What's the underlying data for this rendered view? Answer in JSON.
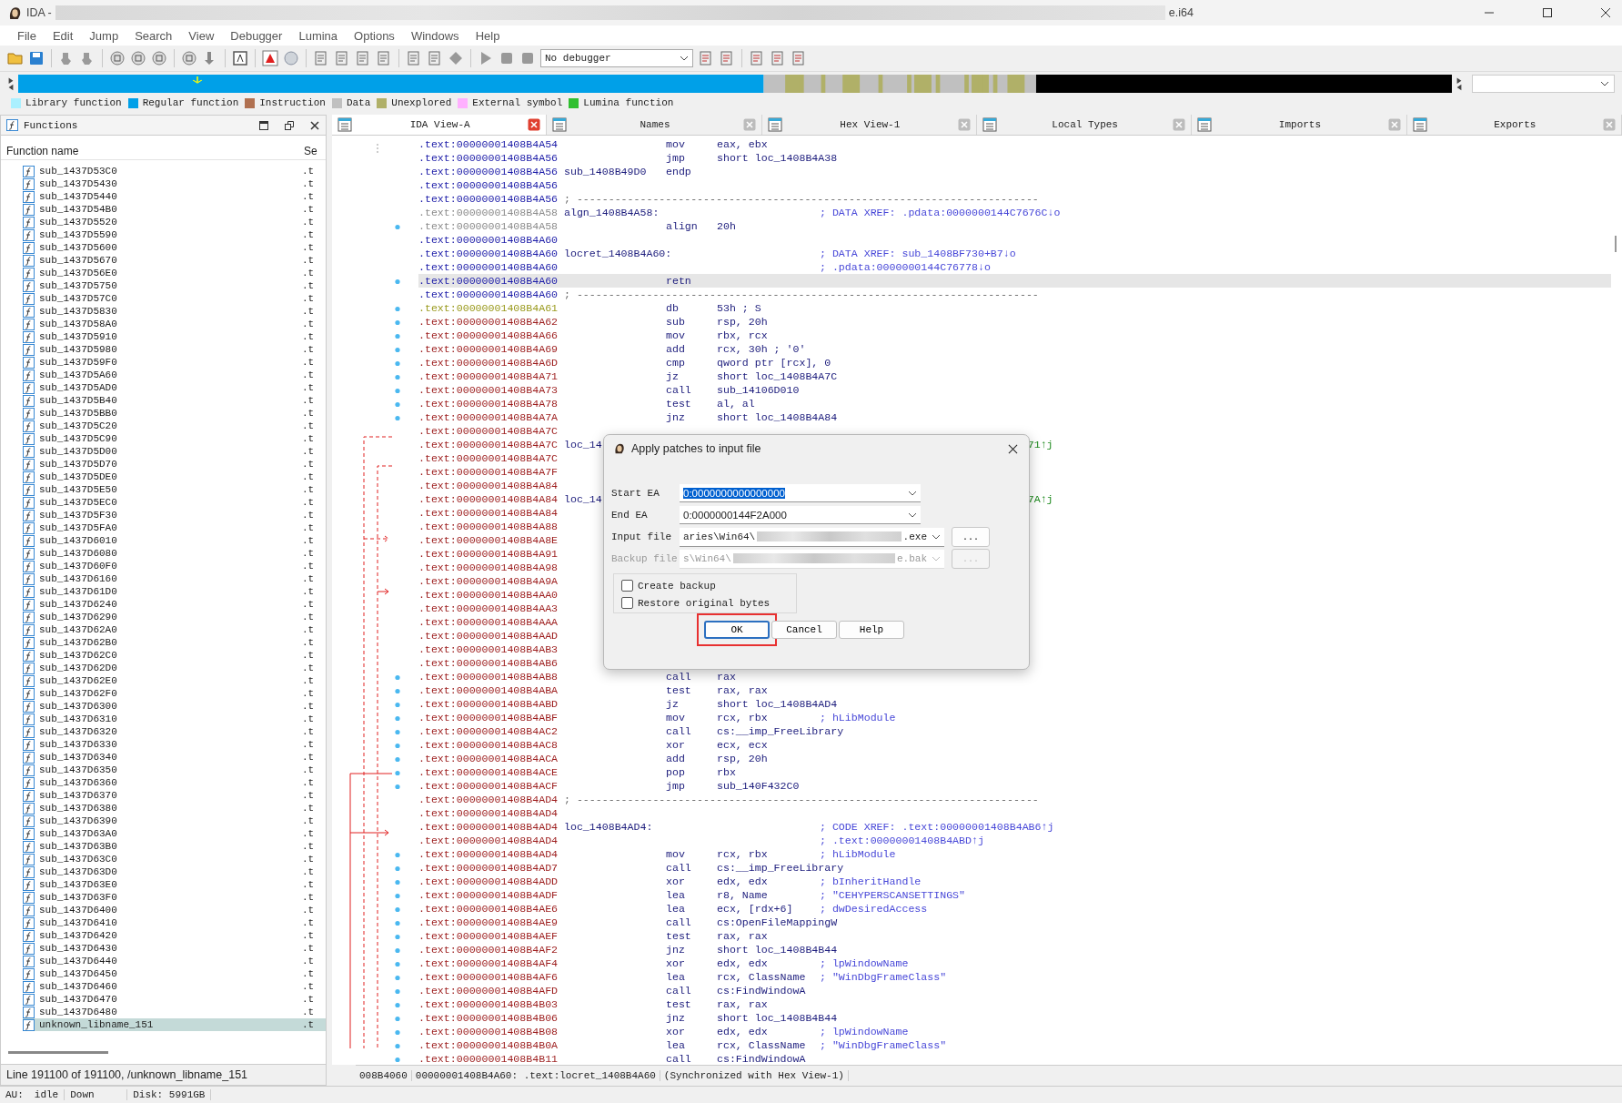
{
  "window": {
    "title": "IDA -",
    "title_suffix": "e.i64"
  },
  "menu": [
    "File",
    "Edit",
    "Jump",
    "Search",
    "View",
    "Debugger",
    "Lumina",
    "Options",
    "Windows",
    "Help"
  ],
  "toolbar": {
    "debugger": "No debugger"
  },
  "legend": [
    {
      "label": "Library function",
      "color": "#aaf0ff"
    },
    {
      "label": "Regular function",
      "color": "#00a0e8"
    },
    {
      "label": "Instruction",
      "color": "#b07050"
    },
    {
      "label": "Data",
      "color": "#c0c0c0"
    },
    {
      "label": "Unexplored",
      "color": "#b0b068"
    },
    {
      "label": "External symbol",
      "color": "#ffb0ff"
    },
    {
      "label": "Lumina function",
      "color": "#30c030"
    }
  ],
  "functions_pane": {
    "title": "Functions",
    "columns": [
      "Function name",
      "Se"
    ],
    "rows": [
      {
        "name": "sub_1437D53C0",
        "segment": ".t",
        "selected": false
      },
      {
        "name": "sub_1437D5430",
        "segment": ".t",
        "selected": false
      },
      {
        "name": "sub_1437D5440",
        "segment": ".t",
        "selected": false
      },
      {
        "name": "sub_1437D54B0",
        "segment": ".t",
        "selected": false
      },
      {
        "name": "sub_1437D5520",
        "segment": ".t",
        "selected": false
      },
      {
        "name": "sub_1437D5590",
        "segment": ".t",
        "selected": false
      },
      {
        "name": "sub_1437D5600",
        "segment": ".t",
        "selected": false
      },
      {
        "name": "sub_1437D5670",
        "segment": ".t",
        "selected": false
      },
      {
        "name": "sub_1437D56E0",
        "segment": ".t",
        "selected": false
      },
      {
        "name": "sub_1437D5750",
        "segment": ".t",
        "selected": false
      },
      {
        "name": "sub_1437D57C0",
        "segment": ".t",
        "selected": false
      },
      {
        "name": "sub_1437D5830",
        "segment": ".t",
        "selected": false
      },
      {
        "name": "sub_1437D58A0",
        "segment": ".t",
        "selected": false
      },
      {
        "name": "sub_1437D5910",
        "segment": ".t",
        "selected": false
      },
      {
        "name": "sub_1437D5980",
        "segment": ".t",
        "selected": false
      },
      {
        "name": "sub_1437D59F0",
        "segment": ".t",
        "selected": false
      },
      {
        "name": "sub_1437D5A60",
        "segment": ".t",
        "selected": false
      },
      {
        "name": "sub_1437D5AD0",
        "segment": ".t",
        "selected": false
      },
      {
        "name": "sub_1437D5B40",
        "segment": ".t",
        "selected": false
      },
      {
        "name": "sub_1437D5BB0",
        "segment": ".t",
        "selected": false
      },
      {
        "name": "sub_1437D5C20",
        "segment": ".t",
        "selected": false
      },
      {
        "name": "sub_1437D5C90",
        "segment": ".t",
        "selected": false
      },
      {
        "name": "sub_1437D5D00",
        "segment": ".t",
        "selected": false
      },
      {
        "name": "sub_1437D5D70",
        "segment": ".t",
        "selected": false
      },
      {
        "name": "sub_1437D5DE0",
        "segment": ".t",
        "selected": false
      },
      {
        "name": "sub_1437D5E50",
        "segment": ".t",
        "selected": false
      },
      {
        "name": "sub_1437D5EC0",
        "segment": ".t",
        "selected": false
      },
      {
        "name": "sub_1437D5F30",
        "segment": ".t",
        "selected": false
      },
      {
        "name": "sub_1437D5FA0",
        "segment": ".t",
        "selected": false
      },
      {
        "name": "sub_1437D6010",
        "segment": ".t",
        "selected": false
      },
      {
        "name": "sub_1437D6080",
        "segment": ".t",
        "selected": false
      },
      {
        "name": "sub_1437D60F0",
        "segment": ".t",
        "selected": false
      },
      {
        "name": "sub_1437D6160",
        "segment": ".t",
        "selected": false
      },
      {
        "name": "sub_1437D61D0",
        "segment": ".t",
        "selected": false
      },
      {
        "name": "sub_1437D6240",
        "segment": ".t",
        "selected": false
      },
      {
        "name": "sub_1437D6290",
        "segment": ".t",
        "selected": false
      },
      {
        "name": "sub_1437D62A0",
        "segment": ".t",
        "selected": false
      },
      {
        "name": "sub_1437D62B0",
        "segment": ".t",
        "selected": false
      },
      {
        "name": "sub_1437D62C0",
        "segment": ".t",
        "selected": false
      },
      {
        "name": "sub_1437D62D0",
        "segment": ".t",
        "selected": false
      },
      {
        "name": "sub_1437D62E0",
        "segment": ".t",
        "selected": false
      },
      {
        "name": "sub_1437D62F0",
        "segment": ".t",
        "selected": false
      },
      {
        "name": "sub_1437D6300",
        "segment": ".t",
        "selected": false
      },
      {
        "name": "sub_1437D6310",
        "segment": ".t",
        "selected": false
      },
      {
        "name": "sub_1437D6320",
        "segment": ".t",
        "selected": false
      },
      {
        "name": "sub_1437D6330",
        "segment": ".t",
        "selected": false
      },
      {
        "name": "sub_1437D6340",
        "segment": ".t",
        "selected": false
      },
      {
        "name": "sub_1437D6350",
        "segment": ".t",
        "selected": false
      },
      {
        "name": "sub_1437D6360",
        "segment": ".t",
        "selected": false
      },
      {
        "name": "sub_1437D6370",
        "segment": ".t",
        "selected": false
      },
      {
        "name": "sub_1437D6380",
        "segment": ".t",
        "selected": false
      },
      {
        "name": "sub_1437D6390",
        "segment": ".t",
        "selected": false
      },
      {
        "name": "sub_1437D63A0",
        "segment": ".t",
        "selected": false
      },
      {
        "name": "sub_1437D63B0",
        "segment": ".t",
        "selected": false
      },
      {
        "name": "sub_1437D63C0",
        "segment": ".t",
        "selected": false
      },
      {
        "name": "sub_1437D63D0",
        "segment": ".t",
        "selected": false
      },
      {
        "name": "sub_1437D63E0",
        "segment": ".t",
        "selected": false
      },
      {
        "name": "sub_1437D63F0",
        "segment": ".t",
        "selected": false
      },
      {
        "name": "sub_1437D6400",
        "segment": ".t",
        "selected": false
      },
      {
        "name": "sub_1437D6410",
        "segment": ".t",
        "selected": false
      },
      {
        "name": "sub_1437D6420",
        "segment": ".t",
        "selected": false
      },
      {
        "name": "sub_1437D6430",
        "segment": ".t",
        "selected": false
      },
      {
        "name": "sub_1437D6440",
        "segment": ".t",
        "selected": false
      },
      {
        "name": "sub_1437D6450",
        "segment": ".t",
        "selected": false
      },
      {
        "name": "sub_1437D6460",
        "segment": ".t",
        "selected": false
      },
      {
        "name": "sub_1437D6470",
        "segment": ".t",
        "selected": false
      },
      {
        "name": "sub_1437D6480",
        "segment": ".t",
        "selected": false
      },
      {
        "name": "unknown_libname_151",
        "segment": ".t",
        "selected": true
      }
    ],
    "status": "Line 191100 of 191100, /unknown_libname_151"
  },
  "tabs": [
    {
      "label": "IDA View-A",
      "selected": true
    },
    {
      "label": "Names",
      "selected": false
    },
    {
      "label": "Hex View-1",
      "selected": false
    },
    {
      "label": "Local Types",
      "selected": false
    },
    {
      "label": "Imports",
      "selected": false
    },
    {
      "label": "Exports",
      "selected": false
    }
  ],
  "listing": [
    {
      "address": ".text:00000001408B4A54",
      "color": "#1c1ca8",
      "mnemonic": "mov",
      "operands": "eax, ebx",
      "selected": false
    },
    {
      "address": ".text:00000001408B4A56",
      "color": "#1c1ca8",
      "mnemonic": "jmp",
      "operands": "short loc_1408B4A38",
      "selected": false
    },
    {
      "address": ".text:00000001408B4A56",
      "color": "#1c1ca8",
      "label": "sub_1408B49D0",
      "mnemonic": "endp",
      "selected": false
    },
    {
      "address": ".text:00000001408B4A56",
      "color": "#1c1ca8",
      "selected": false
    },
    {
      "address": ".text:00000001408B4A56",
      "color": "#1c1ca8",
      "separator": "; -------------------------------------------------------------------------",
      "selected": false
    },
    {
      "address": ".text:00000001408B4A58",
      "color": "#8c8c8c",
      "label": "algn_1408B4A58:",
      "comment": "; DATA XREF: .pdata:0000000144C7676C↓o",
      "selected": false
    },
    {
      "address": ".text:00000001408B4A58",
      "color": "#8c8c8c",
      "mnemonic": "align",
      "operands": "20h",
      "selected": false
    },
    {
      "address": ".text:00000001408B4A60",
      "color": "#1c1ca8",
      "selected": false
    },
    {
      "address": ".text:00000001408B4A60",
      "color": "#1c1ca8",
      "label": "locret_1408B4A60:",
      "comment": "; DATA XREF: sub_1408BF730+B7↓o",
      "selected": false
    },
    {
      "address": ".text:00000001408B4A60",
      "color": "#1c1ca8",
      "comment": "; .pdata:0000000144C76778↓o",
      "selected": false
    },
    {
      "address": ".text:00000001408B4A60",
      "color": "#1c1ca8",
      "mnemonic": "retn",
      "selected": true
    },
    {
      "address": ".text:00000001408B4A60",
      "color": "#1c1ca8",
      "separator": "; -------------------------------------------------------------------------",
      "selected": false
    },
    {
      "address": ".text:00000001408B4A61",
      "color": "#9a9a1e",
      "mnemonic": "db",
      "operands": "53h ; S",
      "selected": false
    },
    {
      "address": ".text:00000001408B4A62",
      "color": "#9c1c1c",
      "mnemonic": "sub",
      "operands": "rsp, 20h",
      "selected": false
    },
    {
      "address": ".text:00000001408B4A66",
      "color": "#9c1c1c",
      "mnemonic": "mov",
      "operands": "rbx, rcx",
      "selected": false
    },
    {
      "address": ".text:00000001408B4A69",
      "color": "#9c1c1c",
      "mnemonic": "add",
      "operands": "rcx, 30h ; '0'",
      "selected": false
    },
    {
      "address": ".text:00000001408B4A6D",
      "color": "#9c1c1c",
      "mnemonic": "cmp",
      "operands": "qword ptr [rcx], 0",
      "selected": false
    },
    {
      "address": ".text:00000001408B4A71",
      "color": "#9c1c1c",
      "mnemonic": "jz",
      "operands": "short loc_1408B4A7C",
      "selected": false
    },
    {
      "address": ".text:00000001408B4A73",
      "color": "#9c1c1c",
      "mnemonic": "call",
      "operands": "sub_14106D010",
      "selected": false
    },
    {
      "address": ".text:00000001408B4A78",
      "color": "#9c1c1c",
      "mnemonic": "test",
      "operands": "al, al",
      "selected": false
    },
    {
      "address": ".text:00000001408B4A7A",
      "color": "#9c1c1c",
      "mnemonic": "jnz",
      "operands": "short loc_1408B4A84",
      "selected": false
    },
    {
      "address": ".text:00000001408B4A7C",
      "color": "#9c1c1c",
      "selected": false
    },
    {
      "address": ".text:00000001408B4A7C",
      "color": "#9c1c1c",
      "label": "loc_14",
      "tail": "71↑j",
      "selected": false
    },
    {
      "address": ".text:00000001408B4A7C",
      "color": "#9c1c1c",
      "selected": false
    },
    {
      "address": ".text:00000001408B4A7F",
      "color": "#9c1c1c",
      "selected": false
    },
    {
      "address": ".text:00000001408B4A84",
      "color": "#9c1c1c",
      "selected": false
    },
    {
      "address": ".text:00000001408B4A84",
      "color": "#9c1c1c",
      "label": "loc_14",
      "tail": "7A↑j",
      "selected": false
    },
    {
      "address": ".text:00000001408B4A84",
      "color": "#9c1c1c",
      "selected": false
    },
    {
      "address": ".text:00000001408B4A88",
      "color": "#9c1c1c",
      "selected": false
    },
    {
      "address": ".text:00000001408B4A8E",
      "color": "#9c1c1c",
      "selected": false
    },
    {
      "address": ".text:00000001408B4A91",
      "color": "#9c1c1c",
      "selected": false
    },
    {
      "address": ".text:00000001408B4A98",
      "color": "#9c1c1c",
      "selected": false
    },
    {
      "address": ".text:00000001408B4A9A",
      "color": "#9c1c1c",
      "selected": false
    },
    {
      "address": ".text:00000001408B4AA0",
      "color": "#9c1c1c",
      "selected": false
    },
    {
      "address": ".text:00000001408B4AA3",
      "color": "#9c1c1c",
      "selected": false
    },
    {
      "address": ".text:00000001408B4AAA",
      "color": "#9c1c1c",
      "selected": false
    },
    {
      "address": ".text:00000001408B4AAD",
      "color": "#9c1c1c",
      "selected": false
    },
    {
      "address": ".text:00000001408B4AB3",
      "color": "#9c1c1c",
      "selected": false
    },
    {
      "address": ".text:00000001408B4AB6",
      "color": "#9c1c1c",
      "selected": false
    },
    {
      "address": ".text:00000001408B4AB8",
      "color": "#9c1c1c",
      "mnemonic": "call",
      "operands": "rax",
      "selected": false
    },
    {
      "address": ".text:00000001408B4ABA",
      "color": "#9c1c1c",
      "mnemonic": "test",
      "operands": "rax, rax",
      "selected": false
    },
    {
      "address": ".text:00000001408B4ABD",
      "color": "#9c1c1c",
      "mnemonic": "jz",
      "operands": "short loc_1408B4AD4",
      "selected": false
    },
    {
      "address": ".text:00000001408B4ABF",
      "color": "#9c1c1c",
      "mnemonic": "mov",
      "operands": "rcx, rbx",
      "comment": "; hLibModule",
      "selected": false
    },
    {
      "address": ".text:00000001408B4AC2",
      "color": "#9c1c1c",
      "mnemonic": "call",
      "operands": "cs:__imp_FreeLibrary",
      "selected": false
    },
    {
      "address": ".text:00000001408B4AC8",
      "color": "#9c1c1c",
      "mnemonic": "xor",
      "operands": "ecx, ecx",
      "selected": false
    },
    {
      "address": ".text:00000001408B4ACA",
      "color": "#9c1c1c",
      "mnemonic": "add",
      "operands": "rsp, 20h",
      "selected": false
    },
    {
      "address": ".text:00000001408B4ACE",
      "color": "#9c1c1c",
      "mnemonic": "pop",
      "operands": "rbx",
      "selected": false
    },
    {
      "address": ".text:00000001408B4ACF",
      "color": "#9c1c1c",
      "mnemonic": "jmp",
      "operands": "sub_140F432C0",
      "selected": false
    },
    {
      "address": ".text:00000001408B4AD4",
      "color": "#9c1c1c",
      "separator": "; -------------------------------------------------------------------------",
      "selected": false
    },
    {
      "address": ".text:00000001408B4AD4",
      "color": "#9c1c1c",
      "selected": false
    },
    {
      "address": ".text:00000001408B4AD4",
      "color": "#9c1c1c",
      "label": "loc_1408B4AD4:",
      "comment": "; CODE XREF: .text:00000001408B4AB6↑j",
      "selected": false
    },
    {
      "address": ".text:00000001408B4AD4",
      "color": "#9c1c1c",
      "comment": "; .text:00000001408B4ABD↑j",
      "selected": false
    },
    {
      "address": ".text:00000001408B4AD4",
      "color": "#9c1c1c",
      "mnemonic": "mov",
      "operands": "rcx, rbx",
      "comment": "; hLibModule",
      "selected": false
    },
    {
      "address": ".text:00000001408B4AD7",
      "color": "#9c1c1c",
      "mnemonic": "call",
      "operands": "cs:__imp_FreeLibrary",
      "selected": false
    },
    {
      "address": ".text:00000001408B4ADD",
      "color": "#9c1c1c",
      "mnemonic": "xor",
      "operands": "edx, edx",
      "comment": "; bInheritHandle",
      "selected": false
    },
    {
      "address": ".text:00000001408B4ADF",
      "color": "#9c1c1c",
      "mnemonic": "lea",
      "operands": "r8, Name",
      "comment": "; \"CEHYPERSCANSETTINGS\"",
      "selected": false
    },
    {
      "address": ".text:00000001408B4AE6",
      "color": "#9c1c1c",
      "mnemonic": "lea",
      "operands": "ecx, [rdx+6]",
      "comment": "; dwDesiredAccess",
      "selected": false
    },
    {
      "address": ".text:00000001408B4AE9",
      "color": "#9c1c1c",
      "mnemonic": "call",
      "operands": "cs:OpenFileMappingW",
      "selected": false
    },
    {
      "address": ".text:00000001408B4AEF",
      "color": "#9c1c1c",
      "mnemonic": "test",
      "operands": "rax, rax",
      "selected": false
    },
    {
      "address": ".text:00000001408B4AF2",
      "color": "#9c1c1c",
      "mnemonic": "jnz",
      "operands": "short loc_1408B4B44",
      "selected": false
    },
    {
      "address": ".text:00000001408B4AF4",
      "color": "#9c1c1c",
      "mnemonic": "xor",
      "operands": "edx, edx",
      "comment": "; lpWindowName",
      "selected": false
    },
    {
      "address": ".text:00000001408B4AF6",
      "color": "#9c1c1c",
      "mnemonic": "lea",
      "operands": "rcx, ClassName",
      "comment": "; \"WinDbgFrameClass\"",
      "selected": false
    },
    {
      "address": ".text:00000001408B4AFD",
      "color": "#9c1c1c",
      "mnemonic": "call",
      "operands": "cs:FindWindowA",
      "selected": false
    },
    {
      "address": ".text:00000001408B4B03",
      "color": "#9c1c1c",
      "mnemonic": "test",
      "operands": "rax, rax",
      "selected": false
    },
    {
      "address": ".text:00000001408B4B06",
      "color": "#9c1c1c",
      "mnemonic": "jnz",
      "operands": "short loc_1408B4B44",
      "selected": false
    },
    {
      "address": ".text:00000001408B4B08",
      "color": "#9c1c1c",
      "mnemonic": "xor",
      "operands": "edx, edx",
      "comment": "; lpWindowName",
      "selected": false
    },
    {
      "address": ".text:00000001408B4B0A",
      "color": "#9c1c1c",
      "mnemonic": "lea",
      "operands": "rcx, ClassName",
      "comment": "; \"WinDbgFrameClass\"",
      "selected": false
    },
    {
      "address": ".text:00000001408B4B11",
      "color": "#9c1c1c",
      "mnemonic": "call",
      "operands": "cs:FindWindowA",
      "selected": false
    }
  ],
  "view_status": [
    "008B4060",
    "00000001408B4A60: .text:locret_1408B4A60",
    "(Synchronized with Hex View-1)"
  ],
  "dialog": {
    "title": "Apply patches to input file",
    "fields": [
      {
        "kind": "combo",
        "label": "Start EA",
        "value": "0:0000000000000000",
        "highlighted": true,
        "disabled": false
      },
      {
        "kind": "combo",
        "label": "End EA",
        "value": "0:0000000144F2A000",
        "highlighted": false,
        "disabled": false
      },
      {
        "kind": "path",
        "label": "Input file",
        "value": "aries\\Win64\\",
        "value_end": ".exe",
        "browse": "...",
        "disabled": false
      },
      {
        "kind": "path",
        "label": "Backup file",
        "value": "s\\Win64\\",
        "value_end": "e.bak",
        "browse": "...",
        "disabled": true
      }
    ],
    "checkboxes": [
      {
        "label": "Create backup",
        "checked": false
      },
      {
        "label": "Restore original bytes",
        "checked": false
      }
    ],
    "buttons": [
      {
        "label": "OK",
        "selected": true
      },
      {
        "label": "Cancel",
        "selected": false
      },
      {
        "label": "Help",
        "selected": false
      }
    ]
  },
  "status_bar": [
    "AU:",
    "idle",
    "Down",
    "Disk: 5991GB"
  ]
}
